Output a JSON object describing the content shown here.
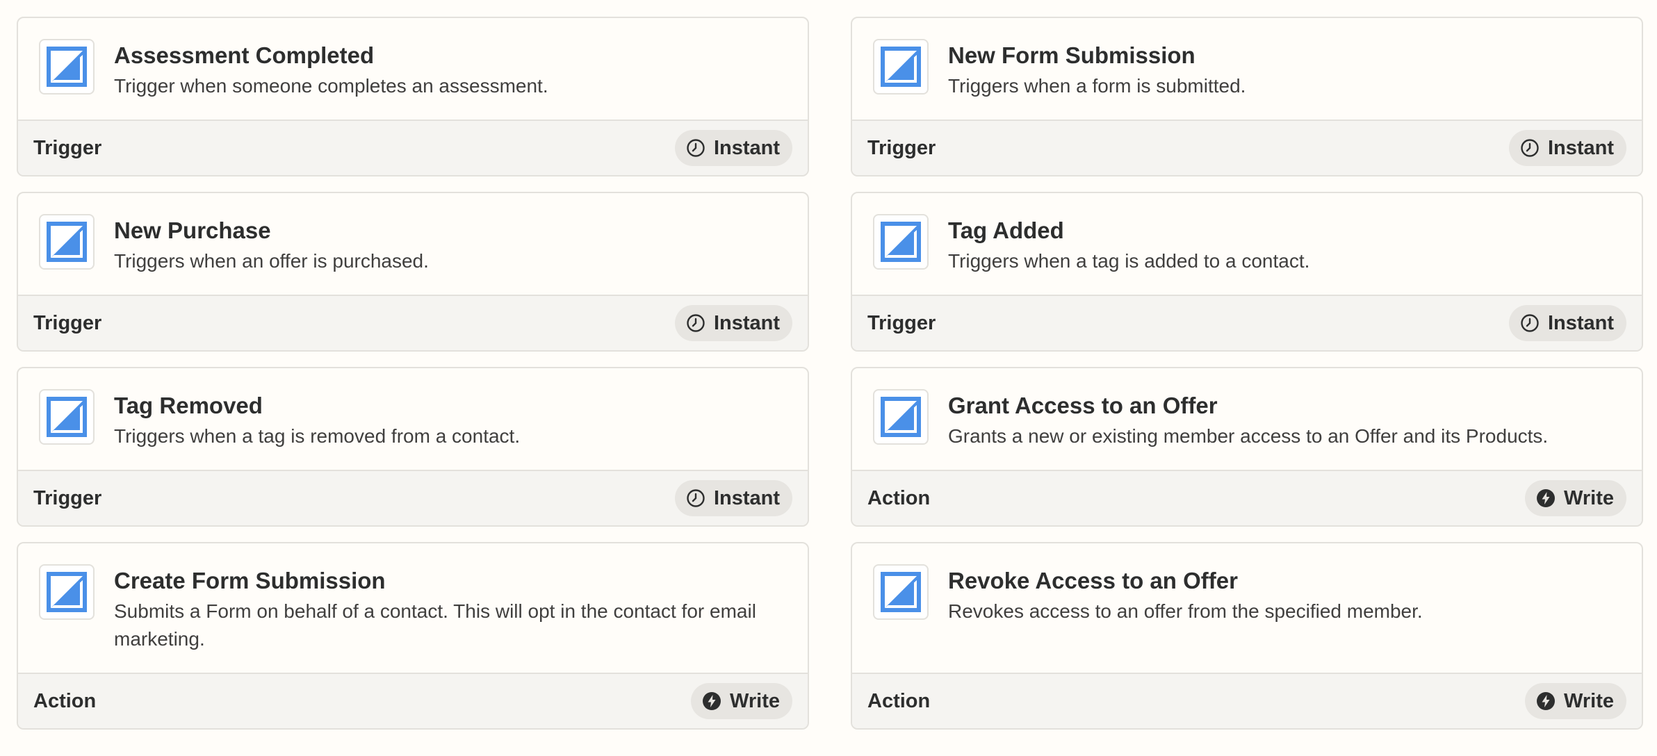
{
  "cards": [
    {
      "title": "Assessment Completed",
      "description": "Trigger when someone completes an assessment.",
      "kind": "Trigger",
      "badge": "Instant",
      "badge_icon": "clock-icon"
    },
    {
      "title": "New Form Submission",
      "description": "Triggers when a form is submitted.",
      "kind": "Trigger",
      "badge": "Instant",
      "badge_icon": "clock-icon"
    },
    {
      "title": "New Purchase",
      "description": "Triggers when an offer is purchased.",
      "kind": "Trigger",
      "badge": "Instant",
      "badge_icon": "clock-icon"
    },
    {
      "title": "Tag Added",
      "description": "Triggers when a tag is added to a contact.",
      "kind": "Trigger",
      "badge": "Instant",
      "badge_icon": "clock-icon"
    },
    {
      "title": "Tag Removed",
      "description": "Triggers when a tag is removed from a contact.",
      "kind": "Trigger",
      "badge": "Instant",
      "badge_icon": "clock-icon"
    },
    {
      "title": "Grant Access to an Offer",
      "description": "Grants a new or existing member access to an Offer and its Products.",
      "kind": "Action",
      "badge": "Write",
      "badge_icon": "lightning-icon"
    },
    {
      "title": "Create Form Submission",
      "description": "Submits a Form on behalf of a contact. This will opt in the contact for email marketing.",
      "kind": "Action",
      "badge": "Write",
      "badge_icon": "lightning-icon"
    },
    {
      "title": "Revoke Access to an Offer",
      "description": "Revokes access to an offer from the specified member.",
      "kind": "Action",
      "badge": "Write",
      "badge_icon": "lightning-icon"
    }
  ],
  "colors": {
    "brand_blue": "#4a90e8",
    "background": "#fffdf9",
    "footer_bg": "#f5f4f1",
    "pill_bg": "#e7e5e1",
    "border": "#e3e1dc"
  },
  "logo_icon": "kajabi-logo-icon"
}
